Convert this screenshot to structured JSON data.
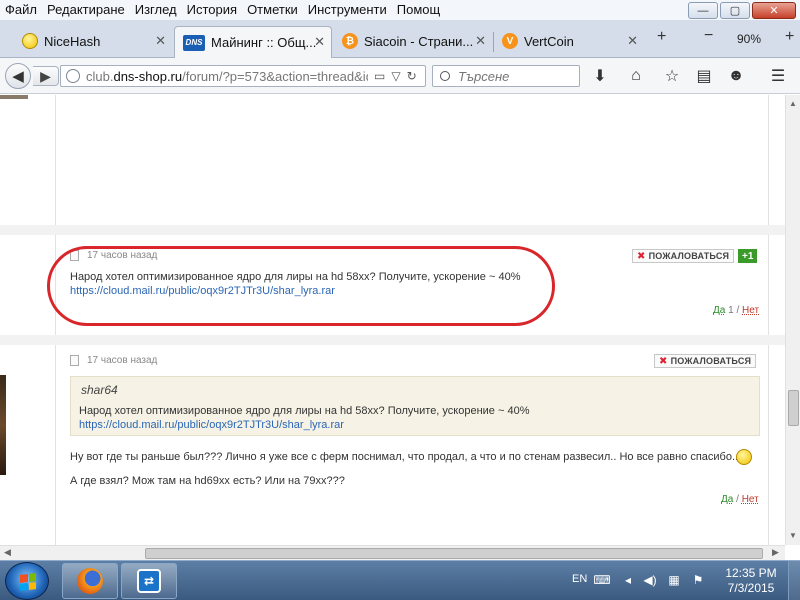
{
  "menubar": {
    "items": [
      "Файл",
      "Редактиране",
      "Изглед",
      "История",
      "Отметки",
      "Инструменти",
      "Помощ"
    ]
  },
  "window_controls": {
    "minimize": "—",
    "maximize": "▢",
    "close": "✕"
  },
  "tabs": [
    {
      "title": "NiceHash",
      "icon": "smiley-favicon"
    },
    {
      "title": "Майнинг :: Общ...",
      "icon": "dns-favicon",
      "favicon_text": "DNS",
      "active": true
    },
    {
      "title": "Siacoin - Страни...",
      "icon": "bitcoin-favicon",
      "favicon_text": "₿"
    },
    {
      "title": "VertCoin",
      "icon": "vertcoin-favicon",
      "favicon_text": "V"
    }
  ],
  "tab_controls": {
    "new_tab": "+",
    "zoom_out": "−",
    "zoom_level": "90%",
    "zoom_in": "+"
  },
  "navbar": {
    "url_prefix": "club.",
    "url_domain": "dns-shop.ru",
    "url_rest": "/forum/?p=573&action=thread&id",
    "search_placeholder": "Търсене"
  },
  "posts": [
    {
      "time": "17 часов назад",
      "report_label": "ПОЖАЛОВАТЬСЯ",
      "rating_badge": "+1",
      "text": "Народ хотел оптимизированное ядро для лиры на hd 58xx? Получите, ускорение ~ 40%",
      "link": "https://cloud.mail.ru/public/oqx9r2TJTr3U/shar_lyra.rar",
      "vote_yes": "Да",
      "vote_count": "1",
      "vote_sep": "/",
      "vote_no": "Нет"
    },
    {
      "time": "17 часов назад",
      "report_label": "ПОЖАЛОВАТЬСЯ",
      "quote_author": "shar64",
      "quote_text": "Народ хотел оптимизированное ядро для лиры на hd 58xx? Получите, ускорение ~ 40%",
      "quote_link": "https://cloud.mail.ru/public/oqx9r2TJTr3U/shar_lyra.rar",
      "text_line1": "Ну вот где ты раньше был??? Лично я уже все с ферм поснимал, что продал, а что и по стенам развесил.. Но все равно спасибо..",
      "text_line2": "А где взял? Мож там на hd69xx есть? Или на 79xx???",
      "vote_yes": "Да",
      "vote_sep": "/",
      "vote_no": "Нет"
    }
  ],
  "taskbar": {
    "apps": [
      "firefox-icon",
      "teamviewer-icon"
    ],
    "language": "EN",
    "time": "12:35 PM",
    "date": "7/3/2015"
  },
  "colors": {
    "annotation_red": "#d9262a",
    "link_blue": "#2a66b5",
    "rating_green": "#3a9a2a",
    "quote_bg": "#f6f3e6"
  }
}
